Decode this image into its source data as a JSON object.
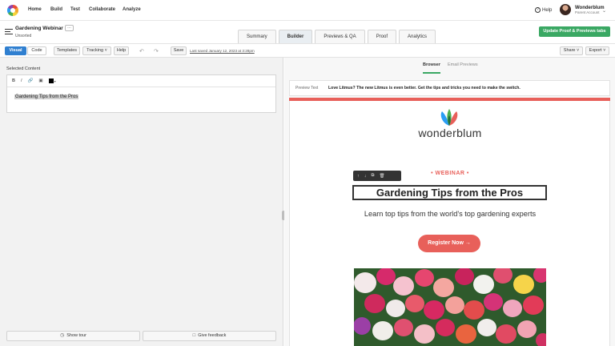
{
  "topnav": {
    "items": [
      "Home",
      "Build",
      "Test",
      "Collaborate",
      "Analyze"
    ],
    "help": "Help",
    "account_name": "Wonderblum",
    "account_sub": "Parent Account"
  },
  "campaign": {
    "title": "Gardening Webinar",
    "subtitle": "Unsorted",
    "more": "…"
  },
  "tabs": [
    "Summary",
    "Builder",
    "Previews & QA",
    "Proof",
    "Analytics"
  ],
  "active_tab": "Builder",
  "update_button": "Update Proof & Previews tabs",
  "toolbar": {
    "visual": "Visual",
    "code": "Code",
    "templates": "Templates",
    "tracking": "Tracking ˅",
    "help": "Help",
    "save": "Save",
    "last_saved": "Last saved January 12, 2023 at 3:28pm",
    "share": "Share ˅",
    "export": "Export ˅"
  },
  "left": {
    "selected_label": "Selected Content",
    "editor_text": "Gardening Tips from the Pros",
    "show_tour": "Show tour",
    "give_feedback": "Give feedback"
  },
  "preview": {
    "tabs": [
      "Browser",
      "Email Previews"
    ],
    "active": "Browser",
    "preview_text_label": "Preview Text",
    "preview_text": "Love Litmus? The new Litmus is even better. Get the tips and tricks you need to make the switch."
  },
  "email": {
    "brand": "wonderblum",
    "eyebrow": "• WEBINAR •",
    "headline": "Gardening Tips from the Pros",
    "subhead": "Learn top tips from the world's top gardening experts",
    "cta": "Register Now →"
  },
  "colors": {
    "accent_green": "#3aa863",
    "visual_blue": "#2f7fd0",
    "brand_coral": "#e8605a"
  }
}
